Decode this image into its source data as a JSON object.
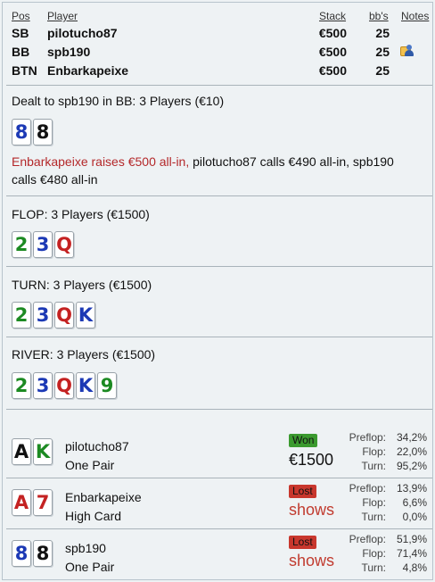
{
  "players_table": {
    "headers": {
      "pos": "Pos",
      "player": "Player",
      "stack": "Stack",
      "bbs": "bb's",
      "notes": "Notes"
    },
    "rows": [
      {
        "pos": "SB",
        "player": "pilotucho87",
        "stack": "€500",
        "bbs": "25",
        "note_icon": null
      },
      {
        "pos": "BB",
        "player": "spb190",
        "stack": "€500",
        "bbs": "25",
        "note_icon": "user-note-icon"
      },
      {
        "pos": "BTN",
        "player": "Enbarkapeixe",
        "stack": "€500",
        "bbs": "25",
        "note_icon": null
      }
    ]
  },
  "preflop": {
    "title": "Dealt to spb190 in BB: 3 Players (€10)",
    "hole_cards": [
      {
        "rank": "8",
        "suit": "d"
      },
      {
        "rank": "8",
        "suit": "s"
      }
    ],
    "action_raise": "Enbarkapeixe raises €500 all-in,",
    "action_rest": " pilotucho87 calls €490 all-in, spb190 calls €480 all-in"
  },
  "flop": {
    "title": "FLOP: 3 Players (€1500)",
    "cards": [
      {
        "rank": "2",
        "suit": "c"
      },
      {
        "rank": "3",
        "suit": "d"
      },
      {
        "rank": "Q",
        "suit": "h"
      }
    ]
  },
  "turn": {
    "title": "TURN: 3 Players (€1500)",
    "cards": [
      {
        "rank": "2",
        "suit": "c"
      },
      {
        "rank": "3",
        "suit": "d"
      },
      {
        "rank": "Q",
        "suit": "h"
      },
      {
        "rank": "K",
        "suit": "d"
      }
    ]
  },
  "river": {
    "title": "RIVER: 3 Players (€1500)",
    "cards": [
      {
        "rank": "2",
        "suit": "c"
      },
      {
        "rank": "3",
        "suit": "d"
      },
      {
        "rank": "Q",
        "suit": "h"
      },
      {
        "rank": "K",
        "suit": "d"
      },
      {
        "rank": "9",
        "suit": "c"
      }
    ]
  },
  "showdown": [
    {
      "player": "pilotucho87",
      "hand": "One Pair",
      "cards": [
        {
          "rank": "A",
          "suit": "s"
        },
        {
          "rank": "K",
          "suit": "c"
        }
      ],
      "status": "Won",
      "status_type": "won",
      "result": "€1500",
      "equity": {
        "preflop_label": "Preflop:",
        "preflop": "34,2%",
        "flop_label": "Flop:",
        "flop": "22,0%",
        "turn_label": "Turn:",
        "turn": "95,2%"
      }
    },
    {
      "player": "Enbarkapeixe",
      "hand": "High Card",
      "cards": [
        {
          "rank": "A",
          "suit": "h"
        },
        {
          "rank": "7",
          "suit": "h"
        }
      ],
      "status": "Lost",
      "status_type": "lost",
      "result": "shows",
      "equity": {
        "preflop_label": "Preflop:",
        "preflop": "13,9%",
        "flop_label": "Flop:",
        "flop": "6,6%",
        "turn_label": "Turn:",
        "turn": "0,0%"
      }
    },
    {
      "player": "spb190",
      "hand": "One Pair",
      "cards": [
        {
          "rank": "8",
          "suit": "d"
        },
        {
          "rank": "8",
          "suit": "s"
        }
      ],
      "status": "Lost",
      "status_type": "lost",
      "result": "shows",
      "equity": {
        "preflop_label": "Preflop:",
        "preflop": "51,9%",
        "flop_label": "Flop:",
        "flop": "71,4%",
        "turn_label": "Turn:",
        "turn": "4,8%"
      }
    }
  ]
}
